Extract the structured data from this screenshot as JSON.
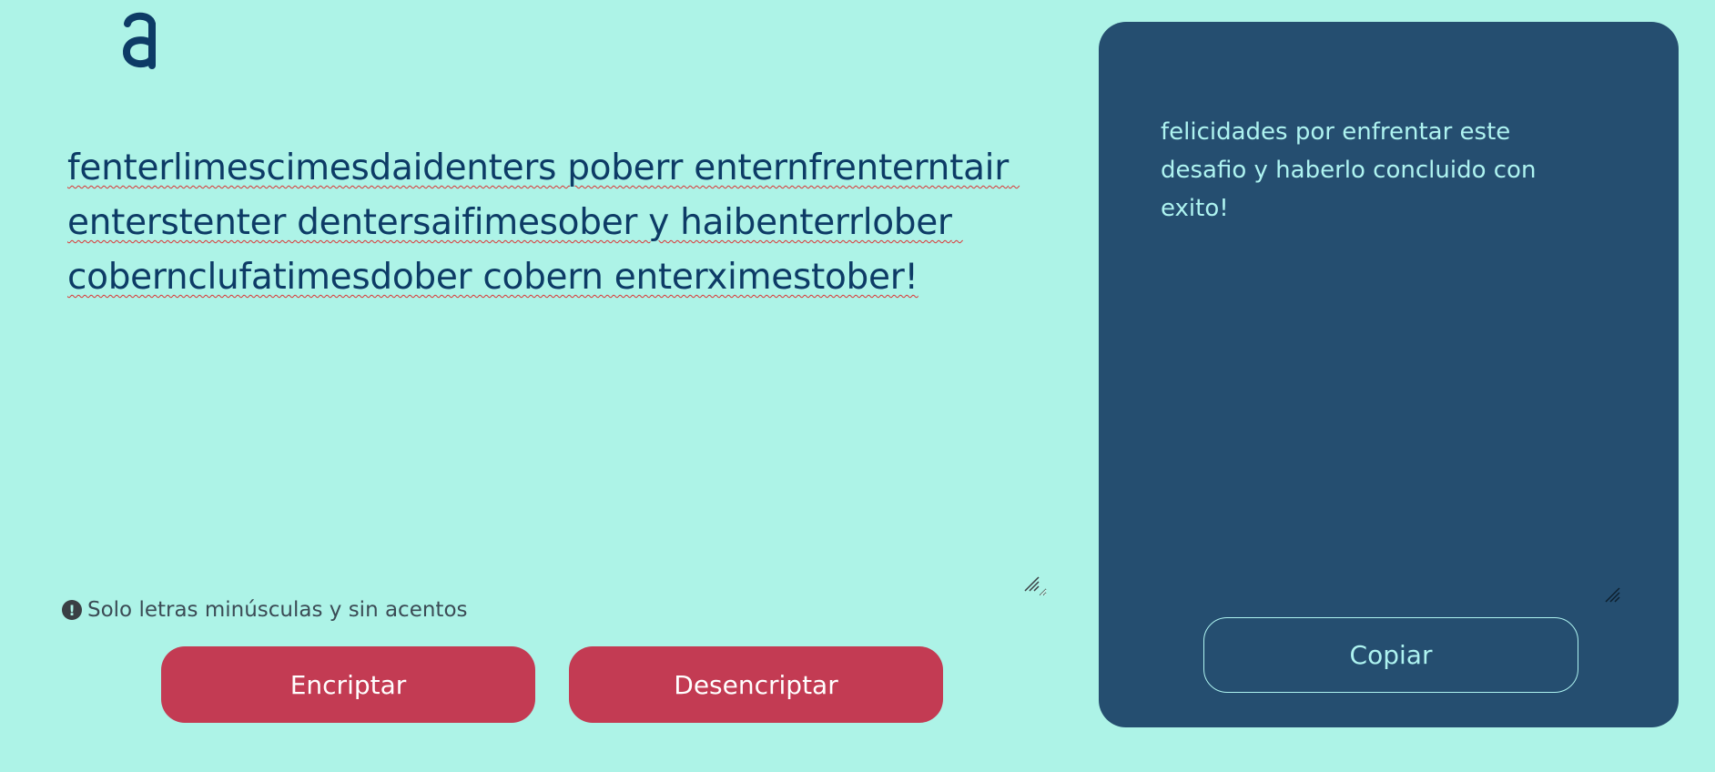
{
  "logo": {
    "glyph": "a"
  },
  "input": {
    "value": "fenterlimescimesdaidenters poberr enternfrenterntair enterstenter dentersaifimesober y haibenterrlober cobernclufatimesdober cobern enterximestober!"
  },
  "hint": {
    "icon": "exclamation-circle-icon",
    "text": "Solo letras minúsculas y sin acentos"
  },
  "buttons": {
    "encrypt_label": "Encriptar",
    "decrypt_label": "Desencriptar",
    "copy_label": "Copiar"
  },
  "output": {
    "text": "felicidades por enfrentar este desafio y haberlo concluido con exito!"
  },
  "colors": {
    "background": "#adf3e7",
    "panel": "#254e70",
    "accent_button": "#c33b53",
    "text_dark": "#0d3b66",
    "text_light": "#aef3f0"
  }
}
